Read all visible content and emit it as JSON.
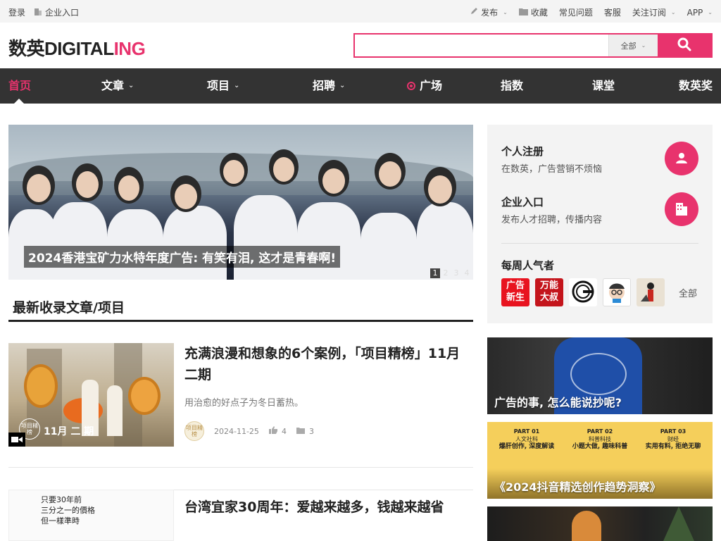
{
  "topbar": {
    "login": "登录",
    "enterprise": "企业入口",
    "publish": "发布",
    "favorites": "收藏",
    "faq": "常见问题",
    "service": "客服",
    "subscribe": "关注订阅",
    "app": "APP"
  },
  "header": {
    "logo_cn": "数英",
    "logo_en_a": "DIGITAL",
    "logo_en_b": "ING",
    "search_placeholder": "",
    "search_scope": "全部"
  },
  "nav": {
    "items": [
      "首页",
      "文章",
      "项目",
      "招聘",
      "广场",
      "指数",
      "课堂",
      "数英奖"
    ]
  },
  "hero": {
    "caption": "2024香港宝矿力水特年度广告: 有笑有泪, 这才是青春啊!",
    "pages": [
      "1",
      "2",
      "3",
      "4"
    ]
  },
  "section": {
    "title": "最新收录文章/项目"
  },
  "articles": [
    {
      "title": "充满浪漫和想象的6个案例，「项目精榜」11月二期",
      "subtitle": "用治愈的好点子为冬日蓄热。",
      "thumb_label": "11月 二 期",
      "avatar_text": "项目精榜",
      "date": "2024-11-25",
      "likes": "4",
      "folders": "3"
    },
    {
      "title": "台湾宜家30周年：爱越来越多，钱越来越省",
      "thumb_lines": [
        "只要30年前",
        "三分之一的價格",
        "但一樣準時"
      ]
    }
  ],
  "sidebar": {
    "personal_title": "个人注册",
    "personal_sub": "在数英，广告营销不烦恼",
    "enterprise_title": "企业入口",
    "enterprise_sub": "发布人才招聘，传播内容",
    "popular_title": "每周人气者",
    "popular_items": [
      {
        "name": "avatar-guanggao",
        "lines": [
          "广告",
          "新生"
        ]
      },
      {
        "name": "avatar-wanneng",
        "lines": [
          "万能",
          "大叔"
        ]
      },
      {
        "name": "avatar-g-logo"
      },
      {
        "name": "avatar-cartoon"
      },
      {
        "name": "avatar-illustration"
      }
    ],
    "all_link": "全部",
    "ads": [
      {
        "caption": "广告的事, 怎么能说抄呢?"
      },
      {
        "caption": "《2024抖音精选创作趋势洞察》",
        "parts": [
          {
            "part": "PART 01",
            "topic": "人文社科",
            "slogan": "爆肝创作, 深度解读"
          },
          {
            "part": "PART 02",
            "topic": "科普科技",
            "slogan": "小题大做, 趣味科普"
          },
          {
            "part": "PART 03",
            "topic": "财经",
            "slogan": "实用有料, 拒绝无聊"
          }
        ]
      },
      {
        "caption": ""
      }
    ]
  },
  "colors": {
    "brand": "#e8336d",
    "nav_bg": "#333333",
    "topbar_bg": "#f4f4f4"
  }
}
